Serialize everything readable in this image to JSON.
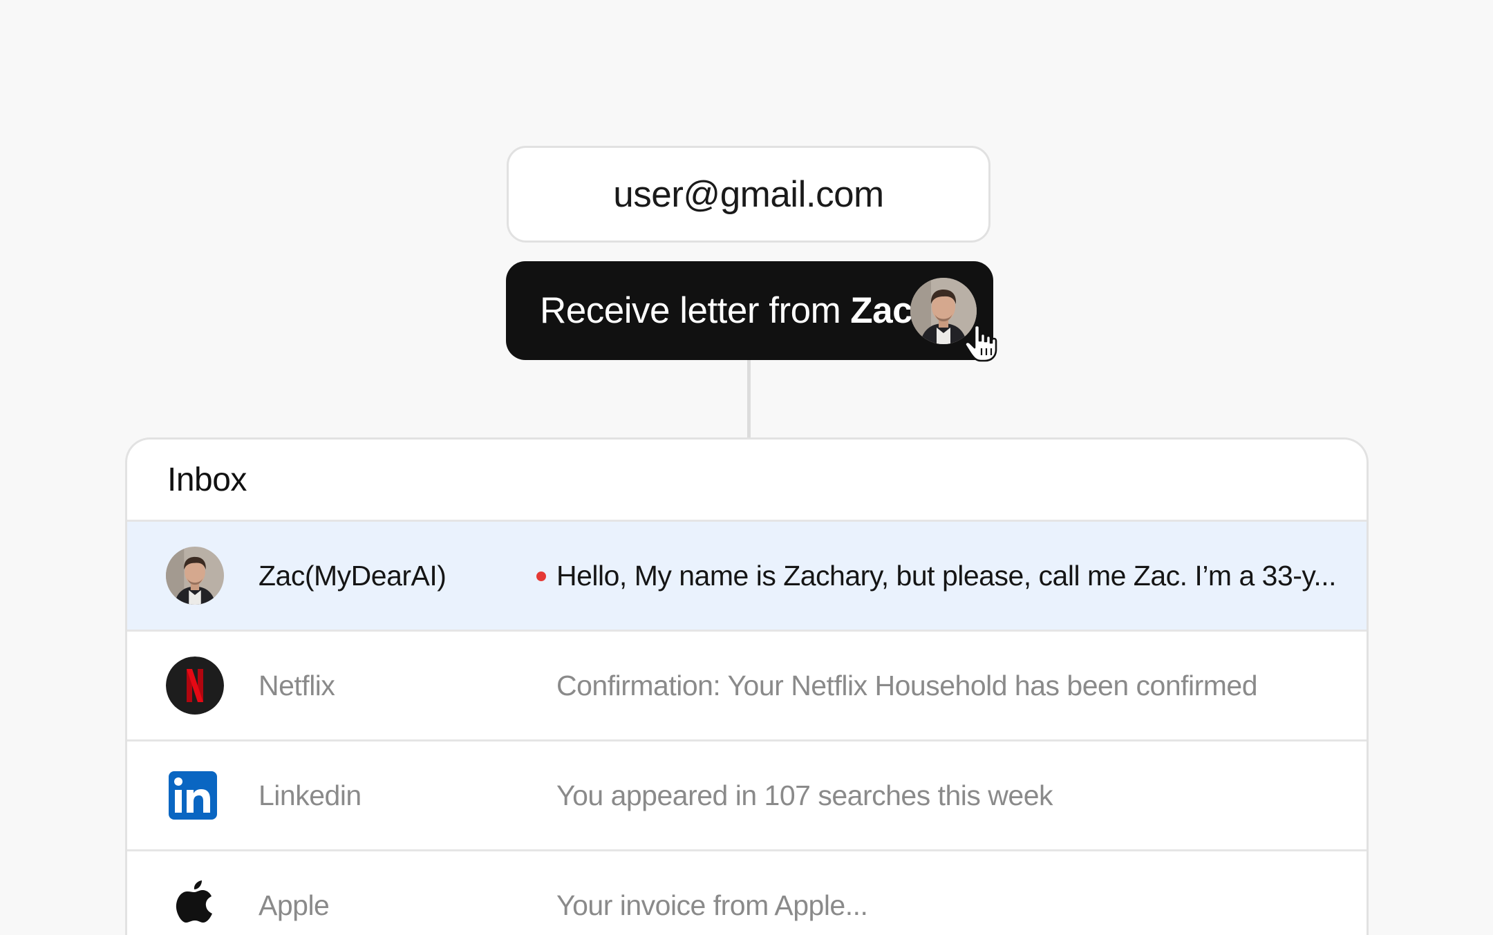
{
  "email_field": {
    "value": "user@gmail.com"
  },
  "cta": {
    "label": "Receive letter from",
    "name": "Zac",
    "avatar_icon": "person-avatar",
    "cursor_icon": "hand-pointer-icon"
  },
  "inbox": {
    "title": "Inbox",
    "rows": [
      {
        "sender": "Zac(MyDearAI)",
        "preview": "Hello, My name is Zachary, but please, call me Zac. I’m a 33-y...",
        "unread": true,
        "icon": "person-avatar",
        "selected": true
      },
      {
        "sender": "Netflix",
        "preview": "Confirmation: Your Netflix Household has been confirmed",
        "unread": false,
        "icon": "netflix-logo-icon"
      },
      {
        "sender": "Linkedin",
        "preview": "You appeared in 107 searches this week",
        "unread": false,
        "icon": "linkedin-logo-icon"
      },
      {
        "sender": "Apple",
        "preview": "Your invoice from Apple...",
        "unread": false,
        "icon": "apple-logo-icon"
      }
    ]
  },
  "colors": {
    "background": "#f8f8f8",
    "cta_background": "#111111",
    "selected_row": "#eaf2fd",
    "unread_dot": "#e53935",
    "netflix_red": "#e50914",
    "linkedin_blue": "#0a66c2",
    "muted_text": "#8a8a8a"
  }
}
